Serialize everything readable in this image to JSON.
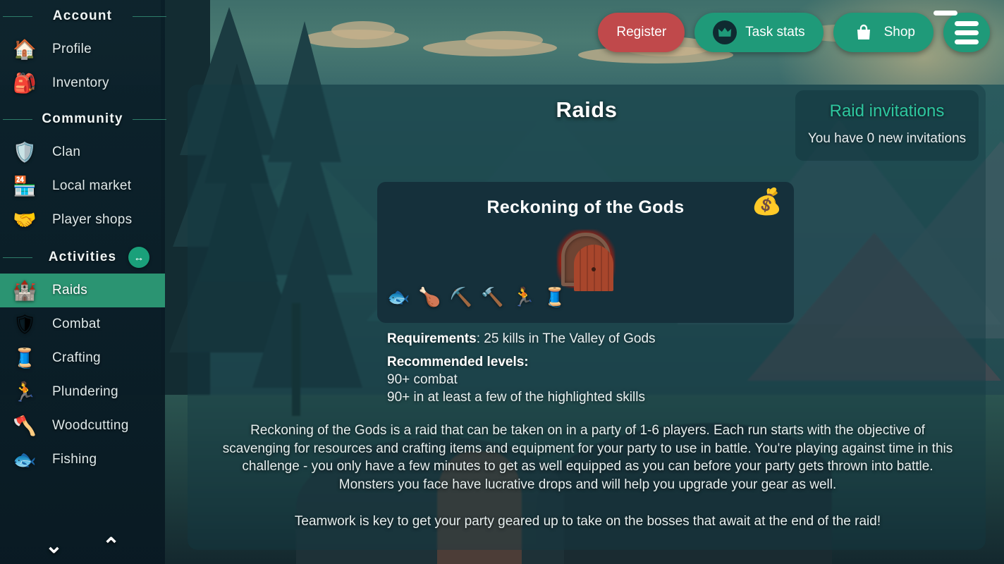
{
  "topbar": {
    "register_label": "Register",
    "task_stats_label": "Task stats",
    "shop_label": "Shop",
    "crown_icon": "crown-icon",
    "shop_icon": "shopping-bag-icon",
    "menu_icon": "hamburger-menu-icon",
    "notification_badge": "",
    "register_color": "#c0494b",
    "teal_color": "#1f9a79",
    "badge_color": "#e8302b"
  },
  "sidebar": {
    "groups": [
      {
        "title": "Account",
        "items": [
          {
            "label": "Profile",
            "icon": "🏠",
            "icon_name": "house-icon",
            "active": false
          },
          {
            "label": "Inventory",
            "icon": "🎒",
            "icon_name": "backpack-icon",
            "active": false
          }
        ]
      },
      {
        "title": "Community",
        "items": [
          {
            "label": "Clan",
            "icon": "🛡️",
            "icon_name": "shield-icon",
            "active": false
          },
          {
            "label": "Local market",
            "icon": "🏪",
            "icon_name": "storefront-icon",
            "active": false
          },
          {
            "label": "Player shops",
            "icon": "🤝",
            "icon_name": "handshake-icon",
            "active": false
          }
        ]
      },
      {
        "title": "Activities",
        "collapse_icon": "↔",
        "items": [
          {
            "label": "Raids",
            "icon": "🏰",
            "icon_name": "castle-icon",
            "active": true
          },
          {
            "label": "Combat",
            "icon": "🛡",
            "icon_name": "combat-icon",
            "active": false
          },
          {
            "label": "Crafting",
            "icon": "🧵",
            "icon_name": "thread-spool-icon",
            "active": false
          },
          {
            "label": "Plundering",
            "icon": "🏃",
            "icon_name": "thief-icon",
            "active": false
          },
          {
            "label": "Woodcutting",
            "icon": "🪓",
            "icon_name": "axe-icon",
            "active": false
          },
          {
            "label": "Fishing",
            "icon": "🐟",
            "icon_name": "fish-icon",
            "active": false
          }
        ]
      }
    ],
    "scroll_down_icon": "⌄",
    "scroll_up_icon": "⌃",
    "active_color": "#2b9472"
  },
  "main": {
    "page_title": "Raids",
    "invitations": {
      "title": "Raid invitations",
      "body": "You have 0 new invitations",
      "title_color": "#2ec79f"
    },
    "raid": {
      "name": "Reckoning of the Gods",
      "reward_icon": "💰",
      "reward_icon_name": "money-bag-icon",
      "thumbnail_name": "raid-door-icon",
      "skills": [
        {
          "icon": "🐟",
          "icon_name": "fish-icon",
          "label": "Fishing"
        },
        {
          "icon": "🍗",
          "icon_name": "cooked-meal-icon",
          "label": "Cooking"
        },
        {
          "icon": "⛏️",
          "icon_name": "pickaxe-icon",
          "label": "Mining"
        },
        {
          "icon": "🔨",
          "icon_name": "hammer-icon",
          "label": "Smithing"
        },
        {
          "icon": "🏃",
          "icon_name": "thief-icon",
          "label": "Plundering"
        },
        {
          "icon": "🧵",
          "icon_name": "thread-spool-icon",
          "label": "Crafting"
        }
      ],
      "requirements_label": "Requirements",
      "requirements_value": ": 25 kills in The Valley of Gods",
      "recommended_label": "Recommended levels:",
      "recommended_lines": [
        "90+ combat",
        "90+ in at least a few of the highlighted skills"
      ],
      "description_p1": "Reckoning of the Gods is a raid that can be taken on in a party of 1-6 players. Each run starts with the objective of scavenging for resources and crafting items and equipment for your party to use in battle. You're playing against time in this challenge - you only have a few minutes to get as well equipped as you can before your party gets thrown into battle. Monsters you face have lucrative drops and will help you upgrade your gear as well.",
      "description_p2": "Teamwork is key to get your party geared up to take on the bosses that await at the end of the raid!"
    }
  }
}
